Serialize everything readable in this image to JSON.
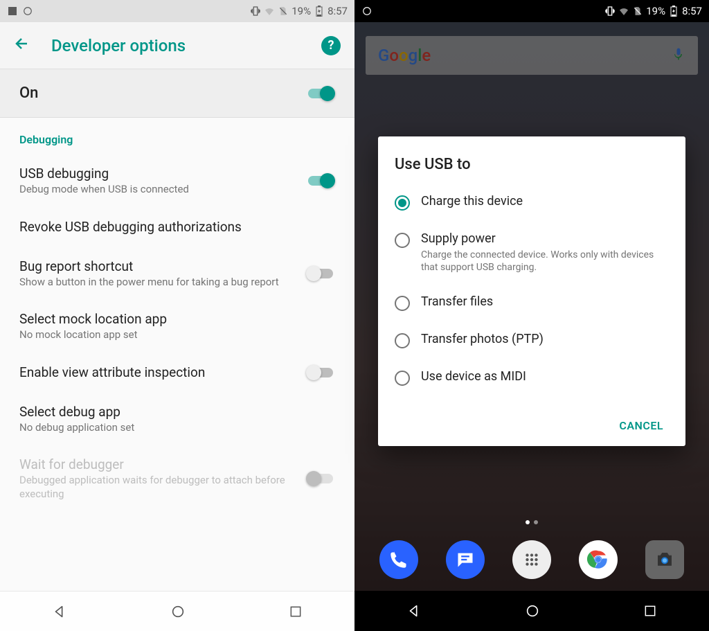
{
  "left": {
    "status": {
      "battery": "19%",
      "time": "8:57"
    },
    "appbar": {
      "title": "Developer options",
      "help": "?"
    },
    "master": {
      "label": "On",
      "on": true
    },
    "section": "Debugging",
    "rows": [
      {
        "title": "USB debugging",
        "subtitle": "Debug mode when USB is connected",
        "toggle": true,
        "on": true
      },
      {
        "title": "Revoke USB debugging authorizations",
        "subtitle": "",
        "toggle": false
      },
      {
        "title": "Bug report shortcut",
        "subtitle": "Show a button in the power menu for taking a bug report",
        "toggle": true,
        "on": false
      },
      {
        "title": "Select mock location app",
        "subtitle": "No mock location app set",
        "toggle": false
      },
      {
        "title": "Enable view attribute inspection",
        "subtitle": "",
        "toggle": true,
        "on": false
      },
      {
        "title": "Select debug app",
        "subtitle": "No debug application set",
        "toggle": false
      },
      {
        "title": "Wait for debugger",
        "subtitle": "Debugged application waits for debugger to attach before executing",
        "toggle": true,
        "on": false,
        "disabled": true
      }
    ]
  },
  "right": {
    "status": {
      "battery": "19%",
      "time": "8:57"
    },
    "search": {
      "brand": "Google"
    },
    "dialog": {
      "title": "Use USB to",
      "options": [
        {
          "label": "Charge this device",
          "sub": "",
          "selected": true
        },
        {
          "label": "Supply power",
          "sub": "Charge the connected device. Works only with devices that support USB charging.",
          "selected": false
        },
        {
          "label": "Transfer files",
          "sub": "",
          "selected": false
        },
        {
          "label": "Transfer photos (PTP)",
          "sub": "",
          "selected": false
        },
        {
          "label": "Use device as MIDI",
          "sub": "",
          "selected": false
        }
      ],
      "cancel": "CANCEL"
    }
  },
  "colors": {
    "accent": "#009688"
  }
}
